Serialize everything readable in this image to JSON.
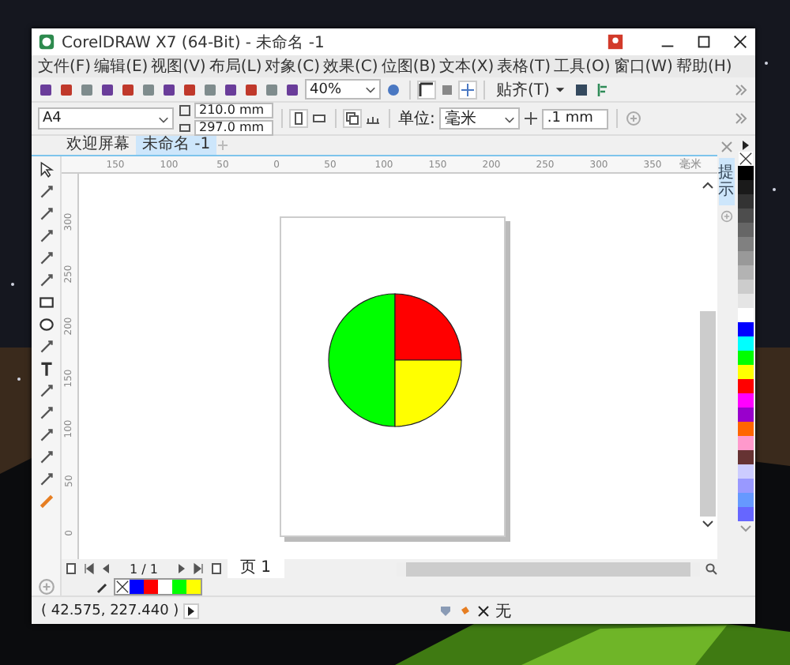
{
  "window": {
    "title": "CorelDRAW X7 (64-Bit) - 未命名 -1"
  },
  "menu": [
    "文件(F)",
    "编辑(E)",
    "视图(V)",
    "布局(L)",
    "对象(C)",
    "效果(C)",
    "位图(B)",
    "文本(X)",
    "表格(T)",
    "工具(O)",
    "窗口(W)",
    "帮助(H)"
  ],
  "toolbar": {
    "zoom": "40%",
    "snap": "贴齐(T)"
  },
  "property_bar": {
    "paper": "A4",
    "width": "210.0 mm",
    "height": "297.0 mm",
    "unit_label": "单位:",
    "unit": "毫米",
    "nudge": ".1 mm"
  },
  "tabs": [
    {
      "label": "欢迎屏幕",
      "selected": false
    },
    {
      "label": "未命名 -1",
      "selected": true
    }
  ],
  "rulers": {
    "horizontal": [
      "150",
      "100",
      "50",
      "0",
      "50",
      "100",
      "150",
      "200",
      "250",
      "300",
      "350"
    ],
    "unit": "毫米",
    "vertical": [
      "300",
      "250",
      "200",
      "150",
      "100",
      "50",
      "0"
    ]
  },
  "docker_tab": "提示",
  "page_nav": {
    "position": "1 / 1",
    "page_tab": "页 1"
  },
  "document_palette": [
    {
      "color": "#0000ff"
    },
    {
      "color": "#ff0000"
    },
    {
      "color": "#ffffff"
    },
    {
      "color": "#00ff00"
    },
    {
      "color": "#ffff00"
    }
  ],
  "color_palette": [
    {
      "color": "#000000"
    },
    {
      "color": "#1a1a1a"
    },
    {
      "color": "#333333"
    },
    {
      "color": "#4d4d4d"
    },
    {
      "color": "#666666"
    },
    {
      "color": "#808080"
    },
    {
      "color": "#999999"
    },
    {
      "color": "#b3b3b3"
    },
    {
      "color": "#cccccc"
    },
    {
      "color": "#e5e5e5"
    },
    {
      "color": "#ffffff"
    },
    {
      "color": "#0000ff"
    },
    {
      "color": "#00ffff"
    },
    {
      "color": "#00ff00"
    },
    {
      "color": "#ffff00"
    },
    {
      "color": "#ff0000"
    },
    {
      "color": "#ff00ff"
    },
    {
      "color": "#9900cc"
    },
    {
      "color": "#ff6600"
    },
    {
      "color": "#ff99cc"
    },
    {
      "color": "#663333"
    },
    {
      "color": "#ccccff"
    },
    {
      "color": "#9999ff"
    },
    {
      "color": "#6699ff"
    },
    {
      "color": "#6666ff"
    }
  ],
  "status_bar": {
    "coordinates": "( 42.575, 227.440 )",
    "fill": "无"
  }
}
